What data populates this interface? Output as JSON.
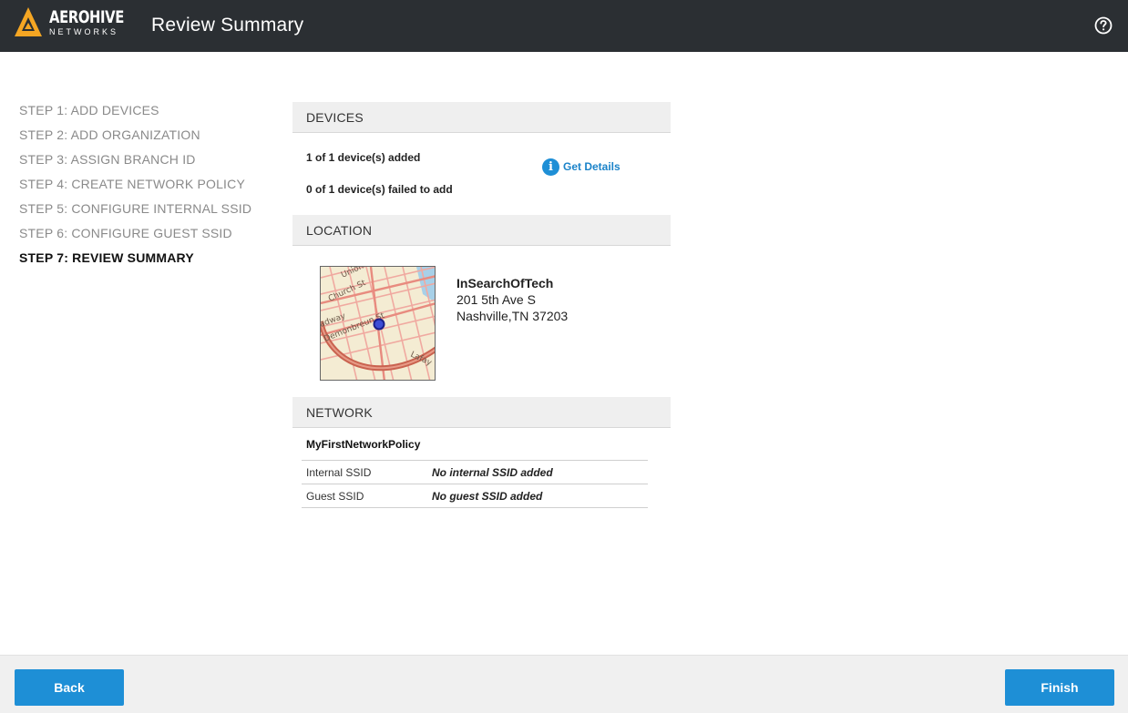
{
  "header": {
    "logo_text": "AEROHIVE",
    "logo_sub": "NETWORKS",
    "title": "Review Summary",
    "help_icon": "help-circle-icon"
  },
  "steps": [
    {
      "label": "STEP 1: ADD DEVICES",
      "active": false
    },
    {
      "label": "STEP 2: ADD ORGANIZATION",
      "active": false
    },
    {
      "label": "STEP 3: ASSIGN BRANCH ID",
      "active": false
    },
    {
      "label": "STEP 4: CREATE NETWORK POLICY",
      "active": false
    },
    {
      "label": "STEP 5: CONFIGURE INTERNAL SSID",
      "active": false
    },
    {
      "label": "STEP 6: CONFIGURE GUEST SSID",
      "active": false
    },
    {
      "label": "STEP 7: REVIEW SUMMARY",
      "active": true
    }
  ],
  "devices": {
    "header": "DEVICES",
    "added": "1 of 1 device(s) added",
    "failed": "0 of 1 device(s) failed to add",
    "details_icon": "info-icon",
    "details_label": "Get Details"
  },
  "location": {
    "header": "LOCATION",
    "name": "InSearchOfTech",
    "address_line1": "201 5th Ave S",
    "address_line2": "Nashville,TN 37203",
    "map_labels": [
      "Union St",
      "Church St",
      "adway",
      "Demonbreun St",
      "Lafay"
    ]
  },
  "network": {
    "header": "NETWORK",
    "policy_name": "MyFirstNetworkPolicy",
    "ssids": [
      {
        "label": "Internal SSID",
        "value": "No internal SSID added"
      },
      {
        "label": "Guest SSID",
        "value": "No guest SSID added"
      }
    ]
  },
  "footer": {
    "back_label": "Back",
    "finish_label": "Finish"
  },
  "colors": {
    "topbar": "#2b2f33",
    "accent": "#1e8fd6",
    "logo": "#f5a623"
  }
}
